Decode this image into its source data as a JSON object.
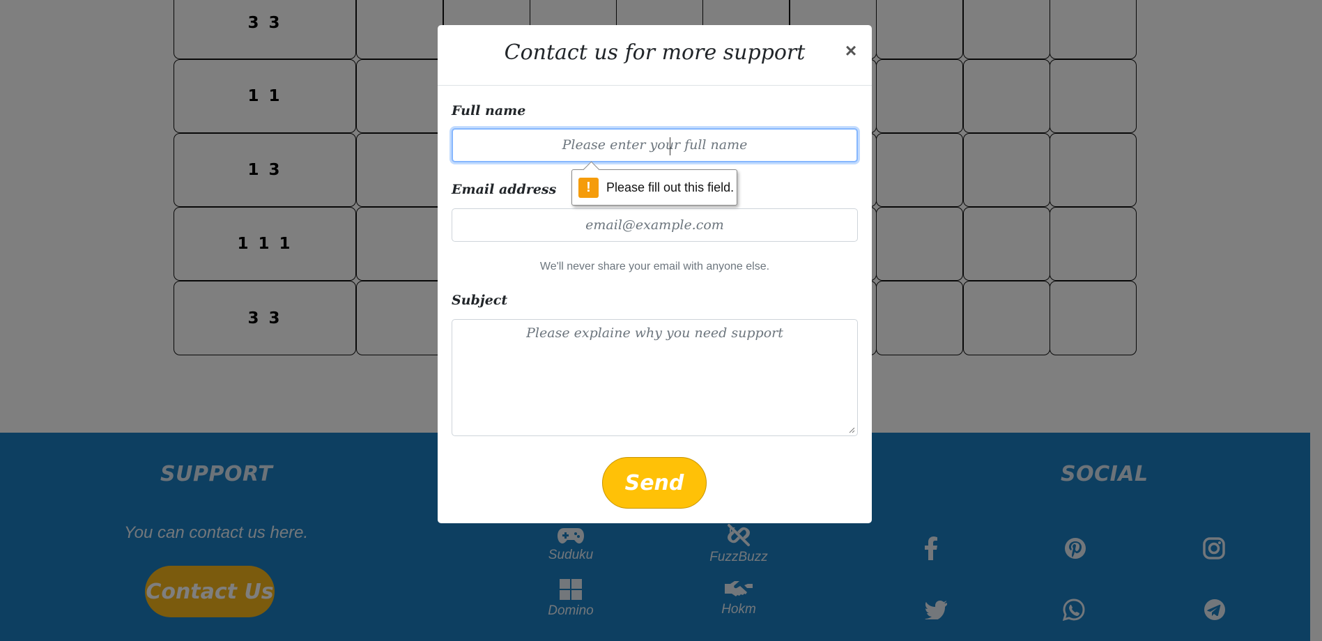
{
  "grid": {
    "row_clues": [
      "3 3",
      "1 1",
      "1 3",
      "1 1 1",
      "3 3"
    ]
  },
  "footer": {
    "support": {
      "heading": "SUPPORT",
      "text": "You can contact us here.",
      "button_label": "Contact Us"
    },
    "games": [
      {
        "label": "Suduku",
        "icon": "gamepad-icon"
      },
      {
        "label": "FuzzBuzz",
        "icon": "link-slash-icon"
      },
      {
        "label": "Domino",
        "icon": "grid-squares-icon"
      },
      {
        "label": "Hokm",
        "icon": "handshake-icon"
      }
    ],
    "social": {
      "heading": "SOCIAL",
      "icons": [
        "facebook-icon",
        "pinterest-icon",
        "instagram-icon",
        "twitter-icon",
        "whatsapp-icon",
        "telegram-icon"
      ]
    }
  },
  "modal": {
    "title": "Contact us for more support",
    "close_label": "×",
    "fullname": {
      "label": "Full name",
      "placeholder": "Please enter your full name"
    },
    "email": {
      "label": "Email address",
      "placeholder": "email@example.com",
      "help": "We'll never share your email with anyone else."
    },
    "subject": {
      "label": "Subject",
      "placeholder": "Please explaine why you need support"
    },
    "send_label": "Send"
  },
  "validation": {
    "message": "Please fill out this field.",
    "icon": "!"
  },
  "colors": {
    "footer_bg": "#1a7fc2",
    "accent_yellow": "#ffc107",
    "warning_orange": "#f59c0b",
    "focus_blue": "#86b7fe"
  }
}
